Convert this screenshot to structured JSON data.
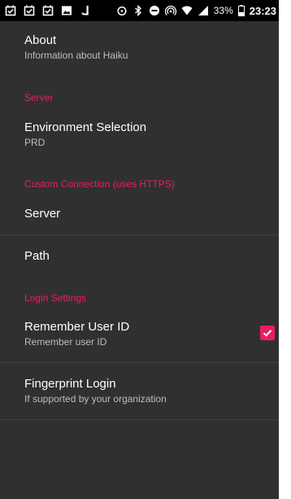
{
  "status_bar": {
    "notification_icons": [
      "checkbox-icon",
      "checkbox-icon",
      "checkbox-icon",
      "image-icon",
      "music-note-icon"
    ],
    "status_icons": [
      "alarm-icon",
      "bluetooth-icon",
      "do-not-disturb-icon",
      "hotspot-icon",
      "wifi-icon",
      "cellular-signal-icon",
      "battery-icon"
    ],
    "battery": "33%",
    "time": "23:23"
  },
  "colors": {
    "background": "#303030",
    "accent": "#e91e63",
    "summary": "#bdbdbd"
  },
  "about": {
    "title": "About",
    "summary": "Information about Haiku"
  },
  "server_category": "Server",
  "environment": {
    "title": "Environment Selection",
    "summary": "PRD"
  },
  "custom_connection_category": "Custom Connection (uses HTTPS)",
  "server": {
    "title": "Server"
  },
  "path": {
    "title": "Path"
  },
  "login_category": "Login Settings",
  "remember_user": {
    "title": "Remember User ID",
    "summary": "Remember user ID",
    "checked": true
  },
  "fingerprint": {
    "title": "Fingerprint Login",
    "summary": "If supported by your organization"
  }
}
